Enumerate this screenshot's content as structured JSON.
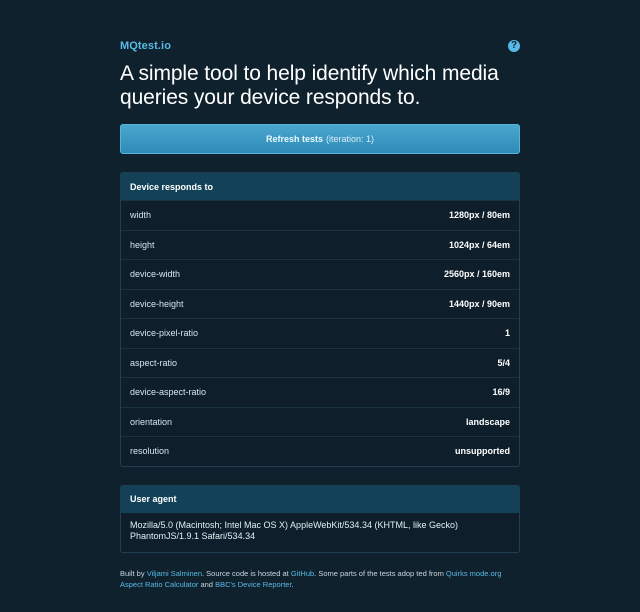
{
  "brand": "MQtest.io",
  "help_icon": "?",
  "title": "A simple tool to help identify which media queries your device responds to.",
  "refresh": {
    "label": "Refresh tests",
    "iteration": "(iteration: 1)"
  },
  "device_panel": {
    "heading": "Device responds to",
    "rows": [
      {
        "key": "width",
        "value": "1280px / 80em"
      },
      {
        "key": "height",
        "value": "1024px / 64em"
      },
      {
        "key": "device-width",
        "value": "2560px / 160em"
      },
      {
        "key": "device-height",
        "value": "1440px / 90em"
      },
      {
        "key": "device-pixel-ratio",
        "value": "1"
      },
      {
        "key": "aspect-ratio",
        "value": "5/4"
      },
      {
        "key": "device-aspect-ratio",
        "value": "16/9"
      },
      {
        "key": "orientation",
        "value": "landscape"
      },
      {
        "key": "resolution",
        "value": "unsupported"
      }
    ]
  },
  "ua_panel": {
    "heading": "User agent",
    "text": "Mozilla/5.0 (Macintosh; Intel Mac OS X) AppleWebKit/534.34 (KHTML, like Gecko) PhantomJS/1.9.1 Safari/534.34"
  },
  "footer": {
    "built_by": "Built by",
    "author": "Viljami Salminen",
    "source_pre": ". Source code is hosted at",
    "github": "GitHub",
    "parts_text": ". Some parts of the tests adop ted from",
    "quirks": "Quirks mode.org Aspect Ratio Calculator",
    "and": "and",
    "bbc": "BBC's Device Reporter",
    "end": "."
  }
}
